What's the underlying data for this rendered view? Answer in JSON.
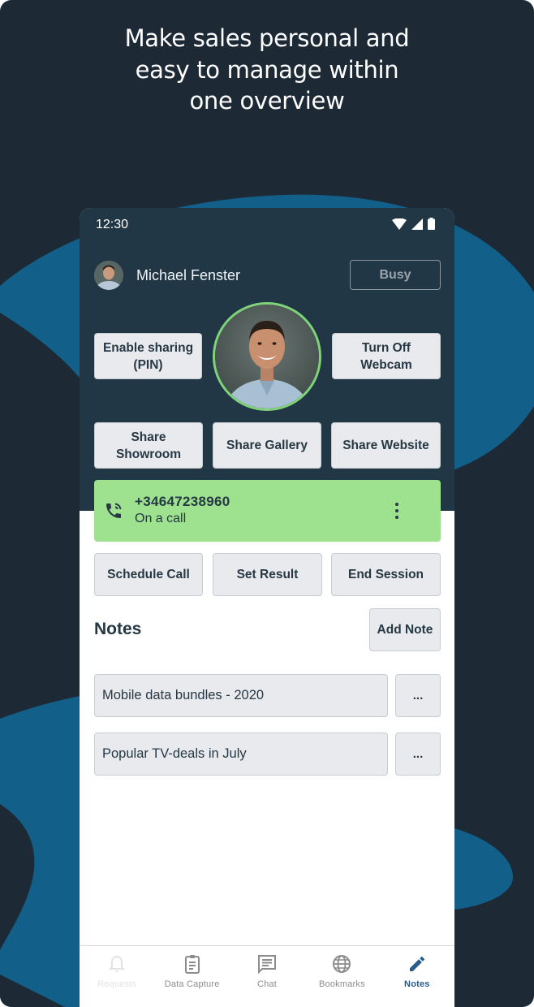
{
  "headline": {
    "line1": "Make sales personal and",
    "line2": "easy to manage within",
    "line3": "one overview"
  },
  "colors": {
    "background_dark": "#1d2a35",
    "blob_blue": "#12608a",
    "phone_header": "#223746",
    "call_bar": "#9ee28f",
    "webcam_ring": "#7fd37a",
    "active_nav": "#2a5b86"
  },
  "status_bar": {
    "time": "12:30",
    "icons": [
      "wifi-icon",
      "signal-icon",
      "battery-icon"
    ]
  },
  "agent": {
    "name": "Michael Fenster",
    "status_button": "Busy"
  },
  "actions": {
    "enable_sharing": "Enable sharing (PIN)",
    "turn_off_webcam": "Turn Off Webcam",
    "share_showroom": "Share Showroom",
    "share_gallery": "Share Gallery",
    "share_website": "Share Website"
  },
  "call": {
    "icon": "phone-in-call-icon",
    "number": "+34647238960",
    "status": "On a call",
    "menu_icon": "more-vertical-icon"
  },
  "call_actions": {
    "schedule_call": "Schedule Call",
    "set_result": "Set Result",
    "end_session": "End Session"
  },
  "notes": {
    "title": "Notes",
    "add_button": "Add Note",
    "items": [
      {
        "label": "Mobile data bundles - 2020",
        "more": "..."
      },
      {
        "label": "Popular TV-deals in July",
        "more": "..."
      }
    ]
  },
  "bottom_nav": {
    "items": [
      {
        "label": "Requests",
        "icon": "bell-icon",
        "state": "disabled"
      },
      {
        "label": "Data Capture",
        "icon": "clipboard-icon",
        "state": "normal"
      },
      {
        "label": "Chat",
        "icon": "chat-icon",
        "state": "normal"
      },
      {
        "label": "Bookmarks",
        "icon": "globe-icon",
        "state": "normal"
      },
      {
        "label": "Notes",
        "icon": "pencil-icon",
        "state": "active"
      }
    ]
  }
}
